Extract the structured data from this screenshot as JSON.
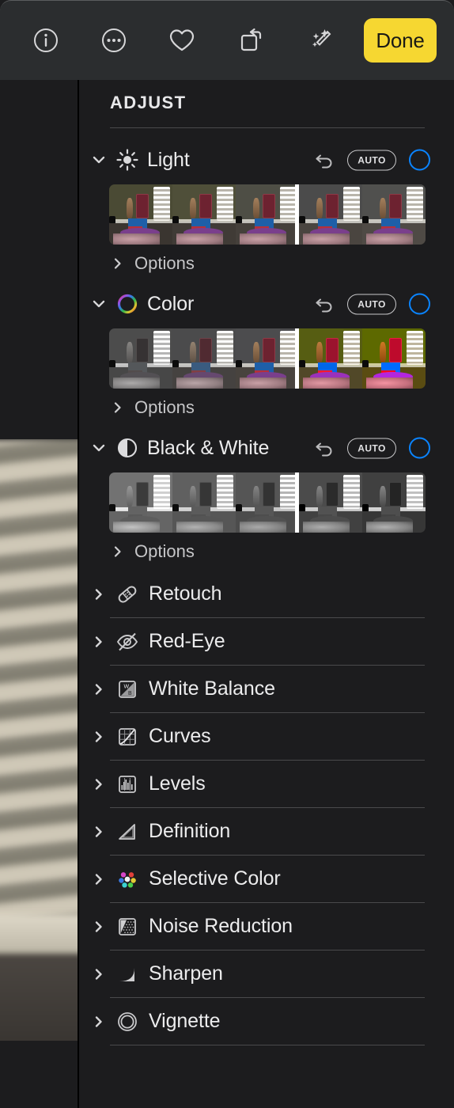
{
  "toolbar": {
    "buttons": [
      {
        "name": "info-icon",
        "label": "Info"
      },
      {
        "name": "more-icon",
        "label": "More"
      },
      {
        "name": "favorite-icon",
        "label": "Favorite"
      },
      {
        "name": "rotate-icon",
        "label": "Rotate"
      },
      {
        "name": "enhance-icon",
        "label": "Auto Enhance"
      }
    ],
    "done_label": "Done",
    "done_color": "#F6D731"
  },
  "panel": {
    "title": "ADJUST",
    "options_label": "Options",
    "auto_label": "AUTO",
    "accent_color": "#0A84FF",
    "expanded_sections": [
      {
        "label": "Light",
        "icon": "sun-icon",
        "expanded": true,
        "auto_label": "AUTO",
        "options_label": "Options",
        "selected_thumb": 3,
        "thumb_count": 5
      },
      {
        "label": "Color",
        "icon": "color-wheel-icon",
        "expanded": true,
        "auto_label": "AUTO",
        "options_label": "Options",
        "selected_thumb": 3,
        "thumb_count": 5
      },
      {
        "label": "Black & White",
        "icon": "half-circle-icon",
        "expanded": true,
        "auto_label": "AUTO",
        "options_label": "Options",
        "selected_thumb": 3,
        "thumb_count": 5
      }
    ],
    "collapsed_sections": [
      {
        "label": "Retouch",
        "icon": "bandage-icon"
      },
      {
        "label": "Red-Eye",
        "icon": "eye-slash-icon"
      },
      {
        "label": "White Balance",
        "icon": "white-balance-icon"
      },
      {
        "label": "Curves",
        "icon": "curves-icon"
      },
      {
        "label": "Levels",
        "icon": "levels-icon"
      },
      {
        "label": "Definition",
        "icon": "definition-icon"
      },
      {
        "label": "Selective Color",
        "icon": "selective-color-icon"
      },
      {
        "label": "Noise Reduction",
        "icon": "noise-reduction-icon"
      },
      {
        "label": "Sharpen",
        "icon": "sharpen-icon"
      },
      {
        "label": "Vignette",
        "icon": "vignette-icon"
      }
    ]
  }
}
